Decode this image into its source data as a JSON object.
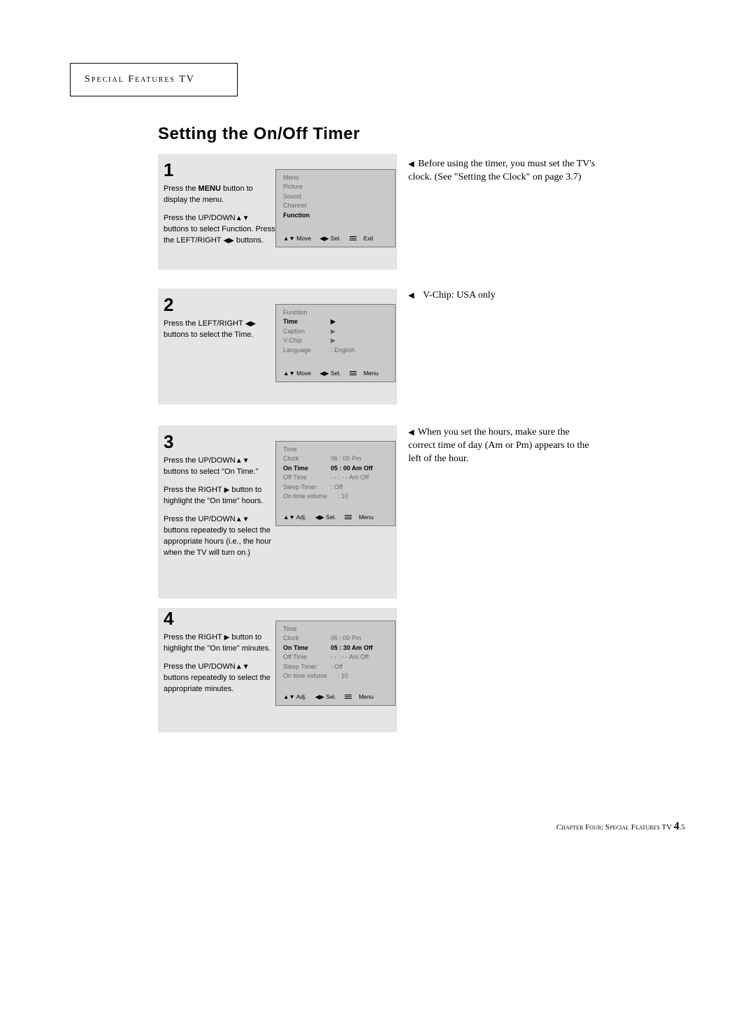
{
  "header": {
    "label": "Special Features TV"
  },
  "title": "Setting the On/Off Timer",
  "notes": {
    "n1": "Before using the timer, you must set the TV's clock. (See \"Setting the Clock\" on page 3.7)",
    "n2": "V-Chip: USA only",
    "n3": "When you set the hours, make sure the correct time of day (Am or Pm) appears to the left of the hour."
  },
  "steps": {
    "s1": {
      "num": "1",
      "a1": "Press the ",
      "a1b": "MENU",
      "a1c": " button to display the menu.",
      "b1": "Press the UP/DOWN",
      "b2": " buttons to select Function. Press the LEFT/RIGHT ",
      "b3": " buttons.",
      "osd": {
        "title": "Menu",
        "l1": "Picture",
        "l2": "Sound",
        "l3": "Channel",
        "l4": "Function",
        "hints": {
          "a": "▲▼ Move",
          "b": "◀▶ Sel.",
          "cLabel": "Exit"
        }
      }
    },
    "s2": {
      "num": "2",
      "a1": "Press the LEFT/RIGHT ",
      "a2": " buttons to select the Time.",
      "osd": {
        "title": "Function",
        "r1": "Time",
        "r2": "Caption",
        "r3": "V-Chip",
        "r4k": "Language",
        "r4v": ": English",
        "hints": {
          "a": "▲▼ Move",
          "b": "◀▶ Sel.",
          "cLabel": "Menu"
        }
      }
    },
    "s3": {
      "num": "3",
      "a1": "Press the UP/DOWN",
      "a2": " buttons to select \"On Time.\"",
      "b1": "Press the RIGHT ",
      "b2": " button to highlight the \"On time\" hours.",
      "c1": "Press the UP/DOWN",
      "c2": " buttons repeatedly to select the appropriate hours (i.e., the hour when the TV will turn on.)",
      "osd": {
        "title": "Time",
        "rows": {
          "clock": {
            "k": "Clock",
            "v": "06 : 00 Pm"
          },
          "ontime": {
            "k": "On Time",
            "v": "05 : 00 Am  Off"
          },
          "offtime": {
            "k": "Off Time",
            "v": "- - : - - Am  Off"
          },
          "sleep": {
            "k": "Sleep Timer",
            "v": ":  Off"
          },
          "vol": {
            "k": "On time volume",
            "v": ":      10"
          }
        },
        "hints": {
          "a": "▲▼ Adj.",
          "b": "◀▶ Sel.",
          "cLabel": "Menu"
        }
      }
    },
    "s4": {
      "num": "4",
      "a1": "Press the RIGHT ",
      "a2": " button to highlight the \"On time\" minutes.",
      "b1": "Press the UP/DOWN",
      "b2": " buttons repeatedly to select the appropriate minutes.",
      "osd": {
        "title": "Time",
        "rows": {
          "clock": {
            "k": "Clock",
            "v": "06 : 00 Pm"
          },
          "ontime": {
            "k": "On Time",
            "v": "05 : 30 Am  Off"
          },
          "offtime": {
            "k": "Off Time",
            "v": "- - : - - Am  Off"
          },
          "sleep": {
            "k": "Sleep Timer",
            "v": ":  Off"
          },
          "vol": {
            "k": "On time volume",
            "v": ":      10"
          }
        },
        "hints": {
          "a": "▲▼ Adj.",
          "b": "◀▶ Sel.",
          "cLabel": "Menu"
        }
      }
    }
  },
  "footer": {
    "a": "Chapter Four: Special Features TV ",
    "b": "4",
    "c": ".5"
  }
}
